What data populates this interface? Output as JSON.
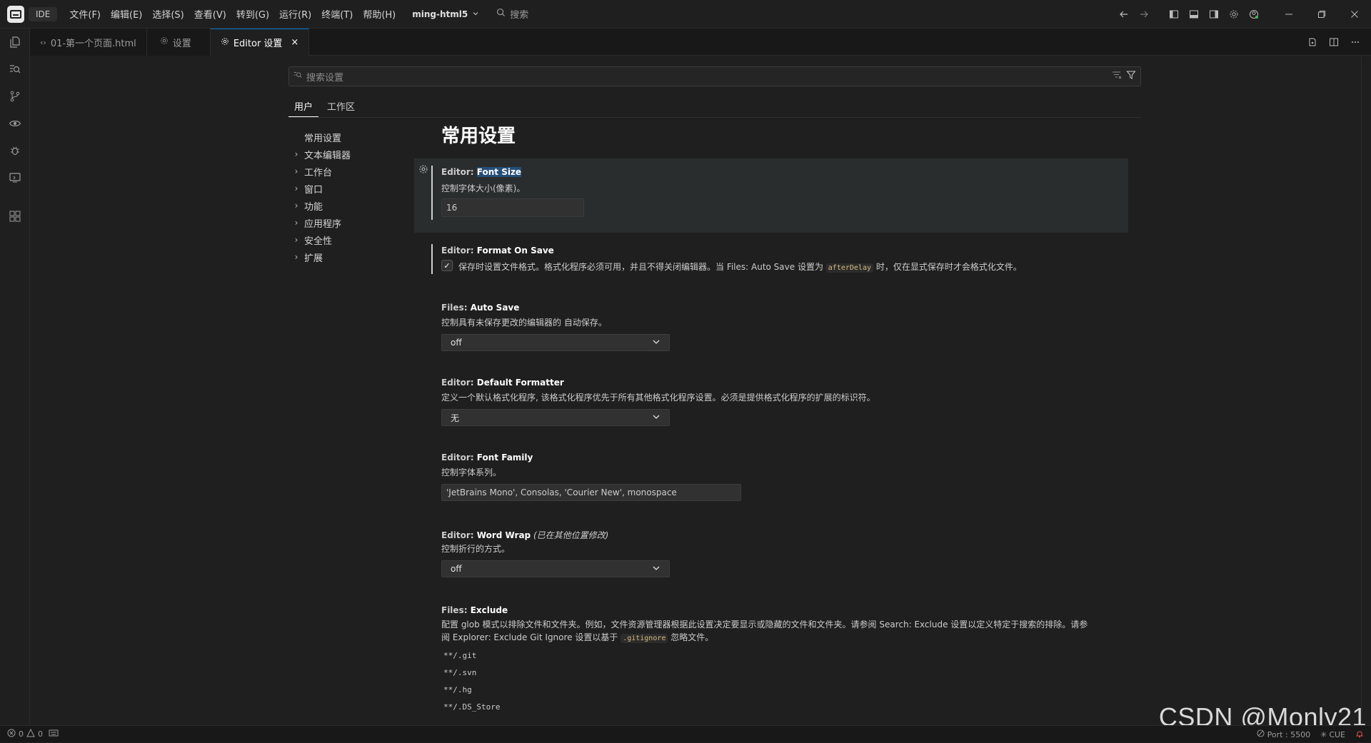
{
  "titlebar": {
    "ide_label": "IDE",
    "menus": [
      "文件(F)",
      "编辑(E)",
      "选择(S)",
      "查看(V)",
      "转到(G)",
      "运行(R)",
      "终端(T)",
      "帮助(H)"
    ],
    "project": "ming-html5",
    "search_label": "搜索"
  },
  "tabs": [
    {
      "label": "01-第一个页面.html",
      "icon": "code-icon"
    },
    {
      "label": "设置",
      "icon": "gear-icon"
    },
    {
      "label": "Editor 设置",
      "icon": "gear-icon",
      "close": "×",
      "active": true
    }
  ],
  "settings": {
    "search_placeholder": "搜索设置",
    "scope_tabs": [
      "用户",
      "工作区"
    ],
    "toc": [
      {
        "label": "常用设置",
        "chevron": ""
      },
      {
        "label": "文本编辑器",
        "chevron": "›"
      },
      {
        "label": "工作台",
        "chevron": "›"
      },
      {
        "label": "窗口",
        "chevron": "›"
      },
      {
        "label": "功能",
        "chevron": "›"
      },
      {
        "label": "应用程序",
        "chevron": "›"
      },
      {
        "label": "安全性",
        "chevron": "›"
      },
      {
        "label": "扩展",
        "chevron": "›"
      }
    ],
    "section_title": "常用设置",
    "font_size": {
      "category": "Editor: ",
      "name": "Font Size",
      "desc": "控制字体大小(像素)。",
      "value": "16"
    },
    "format_on_save": {
      "category": "Editor: ",
      "name": "Format On Save",
      "desc_a": "保存时设置文件格式。格式化程序必须可用，并且不得关闭编辑器。当 Files: Auto Save 设置为 ",
      "code": "afterDelay",
      "desc_b": " 时，仅在显式保存时才会格式化文件。",
      "checked": "✓"
    },
    "auto_save": {
      "category": "Files: ",
      "name": "Auto Save",
      "desc": "控制具有未保存更改的编辑器的 自动保存。",
      "value": "off"
    },
    "default_formatter": {
      "category": "Editor: ",
      "name": "Default Formatter",
      "desc": "定义一个默认格式化程序, 该格式化程序优先于所有其他格式化程序设置。必须是提供格式化程序的扩展的标识符。",
      "value": "无"
    },
    "font_family": {
      "category": "Editor: ",
      "name": "Font Family",
      "desc": "控制字体系列。",
      "value": "'JetBrains Mono', Consolas, 'Courier New', monospace"
    },
    "word_wrap": {
      "category": "Editor: ",
      "name": "Word Wrap",
      "modified": " (已在其他位置修改)",
      "desc": "控制折行的方式。",
      "value": "off"
    },
    "files_exclude": {
      "category": "Files: ",
      "name": "Exclude",
      "desc_a": "配置 glob 模式以排除文件和文件夹。例如，文件资源管理器根据此设置决定要显示或隐藏的文件和文件夹。请参阅 Search: Exclude 设置以定义特定于搜索的排除。请参阅 Explorer: Exclude Git Ignore 设置以基于 ",
      "code": ".gitignore",
      "desc_b": " 忽略文件。",
      "items": [
        "**/.git",
        "**/.svn",
        "**/.hg",
        "**/.DS_Store"
      ]
    }
  },
  "statusbar": {
    "errors": "0",
    "warnings": "0",
    "port": "Port : 5500",
    "cue": "CUE"
  },
  "watermark": "CSDN @Monly21",
  "colors": {
    "accent": "#0078d4",
    "background": "#1f1f1f",
    "selection": "#264f78"
  }
}
